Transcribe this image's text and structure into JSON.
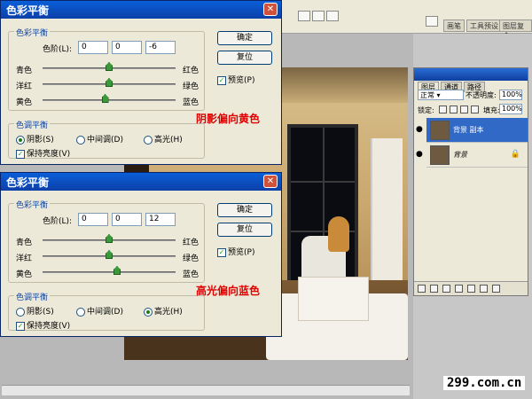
{
  "workspace_tabs": [
    "画笔",
    "工具预设",
    "图层复合"
  ],
  "dialog_top": {
    "title": "色彩平衡",
    "group_balance": "色彩平衡",
    "levels_label": "色阶(L):",
    "levels": [
      "0",
      "0",
      "-6"
    ],
    "sliders": [
      {
        "left": "青色",
        "right": "红色",
        "pos": 0
      },
      {
        "left": "洋红",
        "right": "绿色",
        "pos": 0
      },
      {
        "left": "黄色",
        "right": "蓝色",
        "pos": -6
      }
    ],
    "group_tone": "色调平衡",
    "tones": [
      "阴影(S)",
      "中间调(D)",
      "高光(H)"
    ],
    "selected_tone": 0,
    "preserve": "保持亮度(V)",
    "ok": "确定",
    "reset": "复位",
    "preview": "预览(P)",
    "annotation": "阴影偏向黄色"
  },
  "dialog_bottom": {
    "title": "色彩平衡",
    "group_balance": "色彩平衡",
    "levels_label": "色阶(L):",
    "levels": [
      "0",
      "0",
      "12"
    ],
    "sliders": [
      {
        "left": "青色",
        "right": "红色",
        "pos": 0
      },
      {
        "left": "洋红",
        "right": "绿色",
        "pos": 0
      },
      {
        "left": "黄色",
        "right": "蓝色",
        "pos": 12
      }
    ],
    "group_tone": "色调平衡",
    "tones": [
      "阴影(S)",
      "中间调(D)",
      "高光(H)"
    ],
    "selected_tone": 2,
    "preserve": "保持亮度(V)",
    "ok": "确定",
    "reset": "复位",
    "preview": "预览(P)",
    "annotation": "高光偏向蓝色"
  },
  "layers_panel": {
    "tabs": [
      "图层",
      "通道",
      "路径"
    ],
    "blend_mode": "正常",
    "opacity_label": "不透明度:",
    "opacity": "100%",
    "lock_label": "锁定:",
    "fill_label": "填充:",
    "fill": "100%",
    "layers": [
      {
        "name": "背景 副本",
        "selected": true
      },
      {
        "name": "背景",
        "selected": false
      }
    ]
  },
  "brand": "299.com.cn"
}
